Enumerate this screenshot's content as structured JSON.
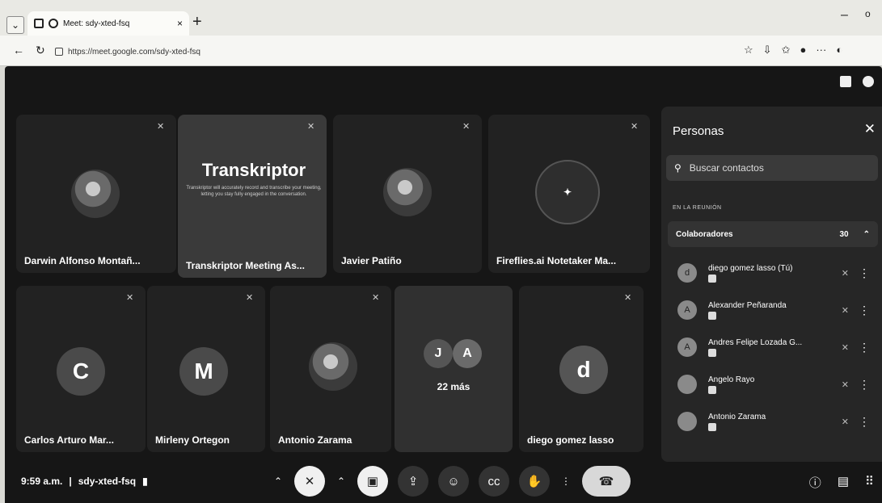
{
  "browser": {
    "tab_title": "Meet: sdy-xted-fsq",
    "url": "https://meet.google.com/sdy-xted-fsq",
    "new_tab": "+",
    "close": "×",
    "minimize": "–",
    "maximize": "o"
  },
  "tiles": [
    {
      "name": "Darwin Alfonso Montañ...",
      "kind": "photo"
    },
    {
      "name": "Transkriptor Meeting As...",
      "kind": "card"
    },
    {
      "name": "Javier Patiño",
      "kind": "photo"
    },
    {
      "name": "Fireflies.ai Notetaker Ma...",
      "kind": "ring"
    },
    {
      "name": "Carlos Arturo Mar...",
      "initial": "C"
    },
    {
      "name": "Mirleny Ortegon",
      "initial": "M"
    },
    {
      "name": "Antonio Zarama",
      "kind": "photo"
    },
    {
      "name": "",
      "initials": [
        "J",
        "A"
      ],
      "more": "22 más"
    },
    {
      "name": "diego gomez lasso",
      "initial": "d"
    }
  ],
  "transkriptor": {
    "logo": "Transkriptor",
    "description": "Transkriptor will accurately record and transcribe your meeting, letting you stay fully engaged in the conversation."
  },
  "bottom": {
    "time": "9:59 a.m.",
    "separator": "|",
    "code": "sdy-xted-fsq"
  },
  "panel": {
    "title": "Personas",
    "search_placeholder": "Buscar contactos",
    "section": "EN LA REUNIÓN",
    "group": "Colaboradores",
    "group_count": "30",
    "people": [
      {
        "name": "diego gomez lasso (Tú)",
        "initial": "d"
      },
      {
        "name": "Alexander Peñaranda",
        "initial": "A"
      },
      {
        "name": "Andres Felipe Lozada G...",
        "initial": "A"
      },
      {
        "name": "Angelo Rayo",
        "initial": ""
      },
      {
        "name": "Antonio Zarama",
        "initial": ""
      }
    ]
  },
  "colors": {
    "meet_bg": "#161616",
    "tile": "#2a2a2a",
    "panel": "#262626"
  }
}
